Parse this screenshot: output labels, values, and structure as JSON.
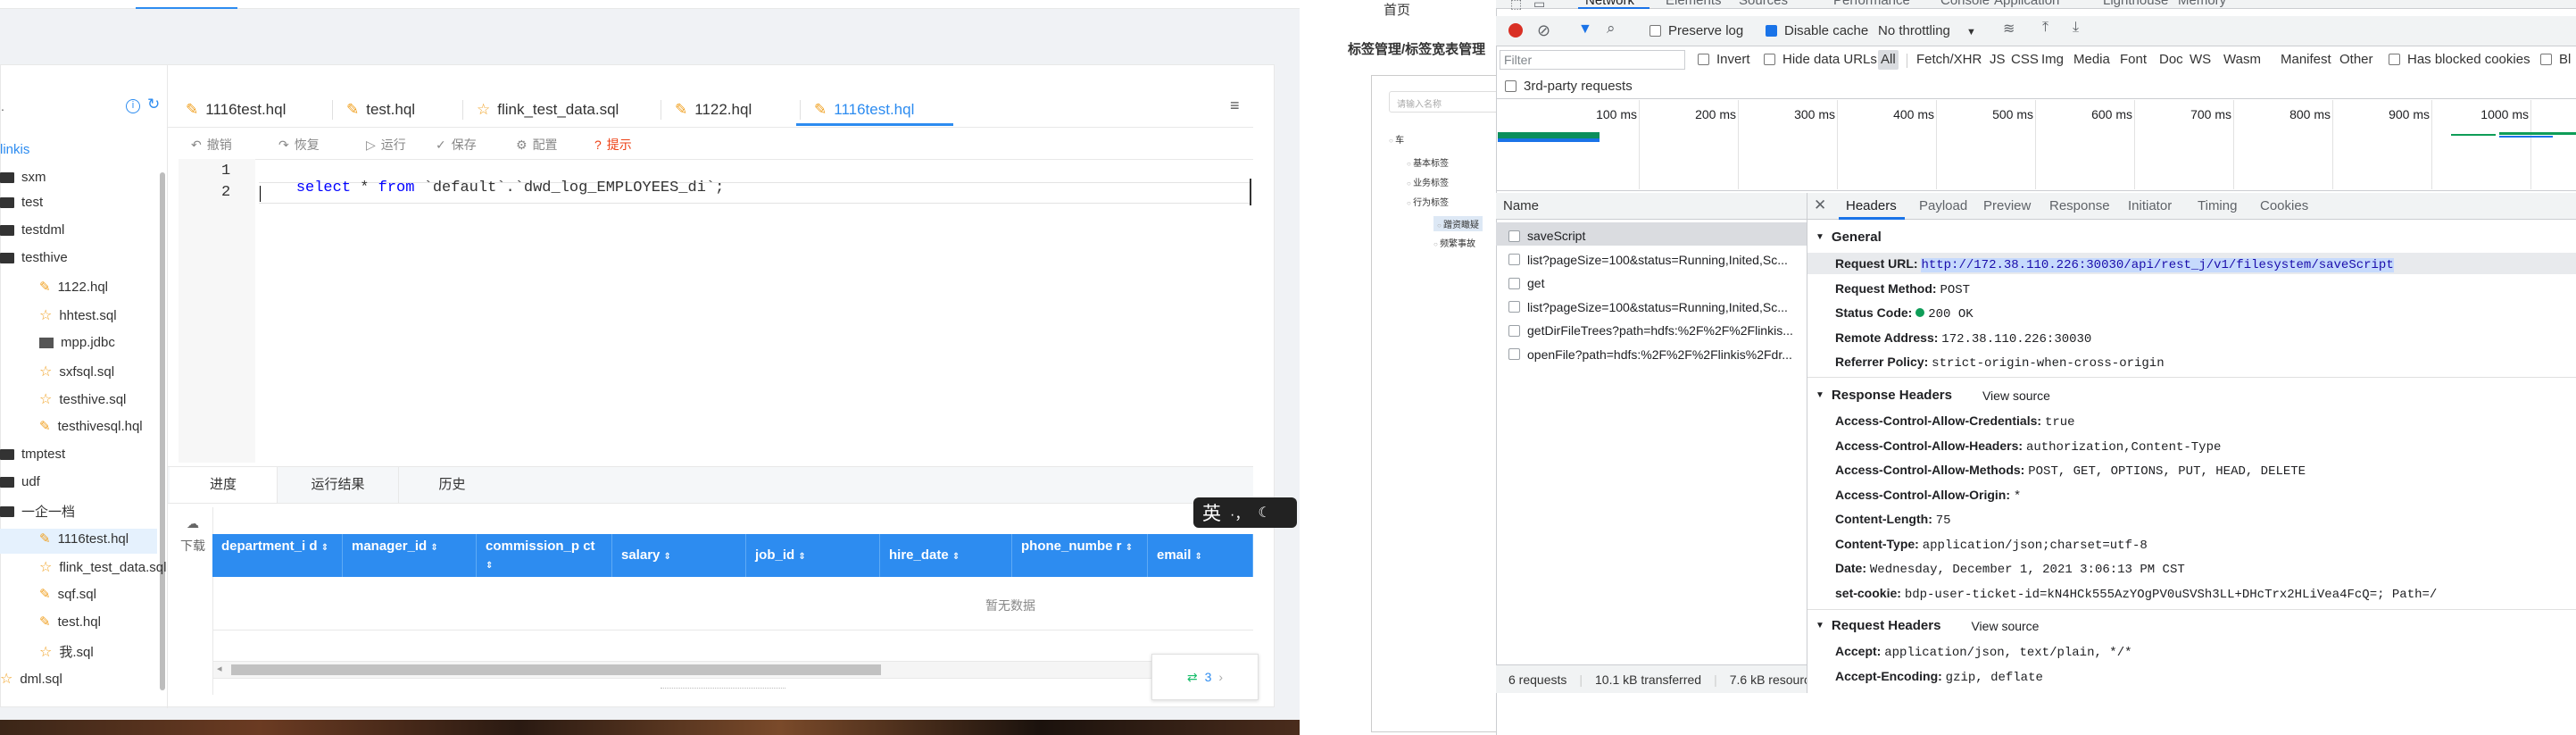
{
  "ide": {
    "tree": [
      "linkis",
      "sxm",
      "test",
      "testdml",
      "testhive",
      "1122.hql",
      "hhtest.sql",
      "mpp.jdbc",
      "sxfsql.sql",
      "testhive.sql",
      "testhivesql.hql",
      "tmptest",
      "udf",
      "一企一档",
      "1116test.hql",
      "flink_test_data.sql",
      "sqf.sql",
      "test.hql",
      "我.sql",
      "dml.sql"
    ],
    "tabs": [
      "1116test.hql",
      "test.hql",
      "flink_test_data.sql",
      "1122.hql",
      "1116test.hql"
    ],
    "toolbar": {
      "undo": "撤销",
      "redo": "恢复",
      "run": "运行",
      "save": "保存",
      "config": "配置",
      "hint": "提示"
    },
    "editor": {
      "line1": "1",
      "line2": "2",
      "code_kw1": "select",
      "code_star": "*",
      "code_kw2": "from",
      "code_rest": "`default`.`dwd_log_EMPLOYEES_di`;"
    },
    "result_tabs": [
      "进度",
      "运行结果",
      "历史"
    ],
    "download": "下载",
    "columns": [
      "department_i d",
      "manager_id",
      "commission_p ct",
      "salary",
      "job_id",
      "hire_date",
      "phone_numbe r",
      "email"
    ],
    "empty": "暂无数据",
    "ime": "英",
    "ime_punct": "·，",
    "pager": "3"
  },
  "right_page": {
    "nav_home": "首页",
    "breadcrumb": "标签管理/标签宽表管理",
    "search_placeholder": "请输入名称",
    "tree": [
      "车",
      "基本标签",
      "业务标签",
      "行为标签",
      "蹭资瞰疑",
      "频繁事故"
    ]
  },
  "devtools": {
    "top_tabs": [
      "Network",
      "Elements",
      "Sources",
      "Performance",
      "Console",
      "Application",
      "Lighthouse",
      "Memory"
    ],
    "toolbar": {
      "preserve_log": "Preserve log",
      "disable_cache": "Disable cache",
      "throttling": "No throttling"
    },
    "filter_placeholder": "Filter",
    "filter_opts": {
      "invert": "Invert",
      "hide_data_urls": "Hide data URLs",
      "blocked_cookies": "Has blocked cookies",
      "blocked_requests": "Bl"
    },
    "types": [
      "All",
      "Fetch/XHR",
      "JS",
      "CSS",
      "Img",
      "Media",
      "Font",
      "Doc",
      "WS",
      "Wasm",
      "Manifest",
      "Other"
    ],
    "third_party": "3rd-party requests",
    "ticks": [
      "100 ms",
      "200 ms",
      "300 ms",
      "400 ms",
      "500 ms",
      "600 ms",
      "700 ms",
      "800 ms",
      "900 ms",
      "1000 ms",
      "1100 m"
    ],
    "name_header": "Name",
    "requests": [
      "saveScript",
      "list?pageSize=100&status=Running,Inited,Sc...",
      "get",
      "list?pageSize=100&status=Running,Inited,Sc...",
      "getDirFileTrees?path=hdfs:%2F%2F%2Flinkis...",
      "openFile?path=hdfs:%2F%2F%2Flinkis%2Fdr..."
    ],
    "status_bar": {
      "requests": "6 requests",
      "transferred": "10.1 kB transferred",
      "resources": "7.6 kB resourc"
    },
    "detail_tabs": [
      "Headers",
      "Payload",
      "Preview",
      "Response",
      "Initiator",
      "Timing",
      "Cookies"
    ],
    "general_title": "General",
    "general": [
      {
        "k": "Request URL:",
        "v": "http://172.38.110.226:30030/api/rest_j/v1/filesystem/saveScript"
      },
      {
        "k": "Request Method:",
        "v": "POST"
      },
      {
        "k": "Status Code:",
        "v": "200 OK"
      },
      {
        "k": "Remote Address:",
        "v": "172.38.110.226:30030"
      },
      {
        "k": "Referrer Policy:",
        "v": "strict-origin-when-cross-origin"
      }
    ],
    "response_headers_title": "Response Headers",
    "view_source": "View source",
    "response_headers": [
      {
        "k": "Access-Control-Allow-Credentials:",
        "v": "true"
      },
      {
        "k": "Access-Control-Allow-Headers:",
        "v": "authorization,Content-Type"
      },
      {
        "k": "Access-Control-Allow-Methods:",
        "v": "POST, GET, OPTIONS, PUT, HEAD, DELETE"
      },
      {
        "k": "Access-Control-Allow-Origin:",
        "v": "*"
      },
      {
        "k": "Content-Length:",
        "v": "75"
      },
      {
        "k": "Content-Type:",
        "v": "application/json;charset=utf-8"
      },
      {
        "k": "Date:",
        "v": "Wednesday, December 1, 2021 3:06:13 PM CST"
      },
      {
        "k": "set-cookie:",
        "v": "bdp-user-ticket-id=kN4HCk555AzYOgPV0uSVSh3LL+DHcTrx2HLiVea4FcQ=; Path=/"
      }
    ],
    "request_headers_title": "Request Headers",
    "request_headers": [
      {
        "k": "Accept:",
        "v": "application/json, text/plain, */*"
      },
      {
        "k": "Accept-Encoding:",
        "v": "gzip, deflate"
      }
    ]
  },
  "colors": {
    "accent": "#2d8cf0",
    "chrome_blue": "#1a73e8",
    "header_blue": "#2d8cf0"
  }
}
